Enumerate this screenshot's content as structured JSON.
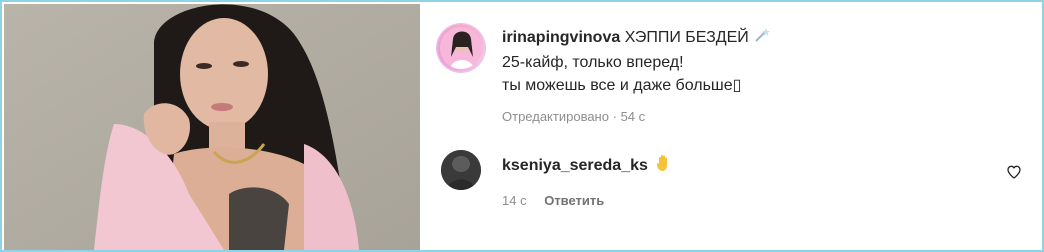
{
  "post_comment": {
    "username": "irinapingvinova",
    "text_line1": "ХЭППИ БЕЗДЕЙ",
    "text_line1_emoji": "magic-wand-icon",
    "text_line2": "25-кайф, только вперед!",
    "text_line3": "ты можешь все и даже больше",
    "text_line3_glyph": "▯",
    "edited_label": "Отредактировано",
    "separator": "·",
    "time": "54 с"
  },
  "reply_comment": {
    "username": "kseniya_sereda_ks",
    "emoji": "raised-hand-icon",
    "time": "14 с",
    "reply_label": "Ответить"
  },
  "colors": {
    "frame_border": "#8fd3e6",
    "text_primary": "#262626",
    "text_secondary": "#8e8e8e",
    "photo_background": "#b9b4a9",
    "shirt_pink": "#f3c7d2"
  }
}
